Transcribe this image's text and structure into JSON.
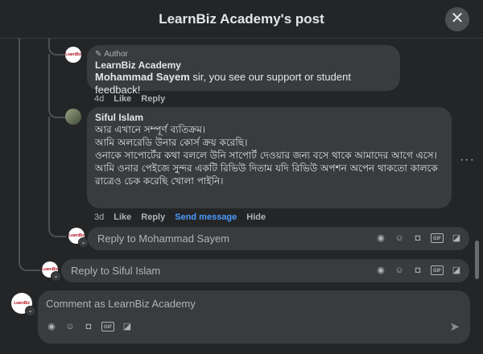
{
  "header": {
    "title": "LearnBiz Academy's post",
    "close_label": "✕"
  },
  "comments": {
    "author_reply": {
      "author_tag": "Author",
      "name": "LearnBiz Academy",
      "mention": "Mohammad Sayem",
      "text": " sir, you see our support or student feedback!",
      "time": "4d",
      "like_label": "Like",
      "reply_label": "Reply"
    },
    "siful_comment": {
      "name": "Siful Islam",
      "text": "আর এখানে সম্পূর্ণ ব্যতিক্রম।\nআমি অলরেডি উনার কোর্স ক্রয় করেছি।\nওনাকে সাপোর্টের কথা বললে উনি সাপোর্ট দেওয়ার জন্য বসে থাকে আমাদের আগে এসে।\nআমি ওনার পেইজে সুন্দর একটি রিভিউ দিতাম যদি রিভিউ অপশন অপেন থাকতো কালকে রাত্রেও চেক করেছি খোলা পাইনি।",
      "time": "3d",
      "like_label": "Like",
      "reply_label": "Reply",
      "send_message_label": "Send message",
      "hide_label": "Hide"
    }
  },
  "reply_sayem": {
    "placeholder": "Reply to Mohammad Sayem"
  },
  "reply_siful": {
    "placeholder": "Reply to Siful Islam"
  },
  "main_comment": {
    "placeholder": "Comment as LearnBiz Academy"
  },
  "avatar_mark": "LearnBiz",
  "icons": {
    "avatar_sticker": "avatar-sticker-icon",
    "emoji": "emoji-icon",
    "camera": "camera-icon",
    "gif": "GIF",
    "sticker": "sticker-icon",
    "send": "send-icon"
  },
  "colors": {
    "background": "#242526",
    "bubble": "#3a3b3c",
    "link_blue": "#4b9cff"
  }
}
